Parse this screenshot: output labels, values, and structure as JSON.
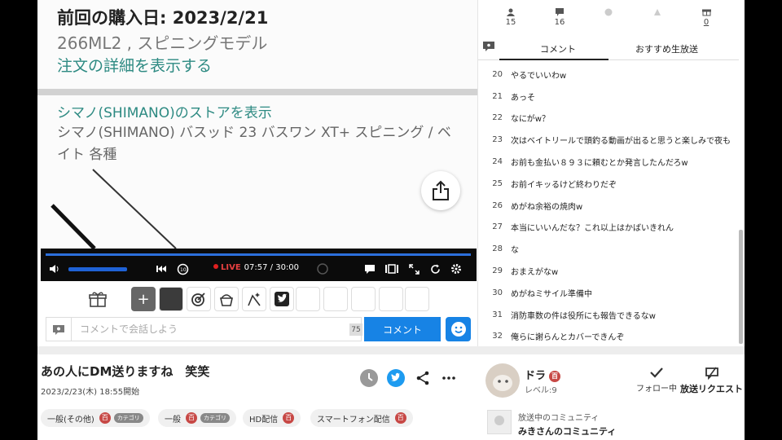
{
  "video": {
    "purchase_date": "前回の購入日: 2023/2/21",
    "purchase_model": "266ML2 , スピニングモデル",
    "order_link": "注文の詳細を表示する",
    "store_link": "シマノ(SHIMANO)のストアを表示",
    "product_name": "シマノ(SHIMANO) バスッド 23 バスワン XT+ スピニング / ベイト 各種"
  },
  "player": {
    "live_label": "LIVE",
    "time": "07:57 / 30:00",
    "progress": 1.0,
    "volume": 0.5
  },
  "comment_form": {
    "placeholder": "コメントで会話しよう",
    "char_count": "75",
    "submit_label": "コメント"
  },
  "program": {
    "title": "あの人にDM送りますね　笑笑",
    "start": "2023/2/23(木) 18:55開始",
    "tags": [
      {
        "label": "一般(その他)",
        "badge": "百",
        "category": "カテゴリ"
      },
      {
        "label": "一般",
        "badge": "百",
        "category": "カテゴリ"
      },
      {
        "label": "HD配信",
        "badge": "百",
        "category": ""
      },
      {
        "label": "スマートフォン配信",
        "badge": "百",
        "category": ""
      }
    ]
  },
  "panel": {
    "stats": [
      {
        "icon": "viewer-icon",
        "value": "15"
      },
      {
        "icon": "comment-count-icon",
        "value": "16"
      },
      {
        "icon": "ad-point-icon",
        "value": ""
      },
      {
        "icon": "gift-point-icon",
        "value": ""
      },
      {
        "icon": "gift-icon",
        "value": "0"
      }
    ],
    "tabs": [
      "コメント",
      "おすすめ生放送"
    ],
    "comments": [
      {
        "no": "20",
        "text": "やるでいいわw"
      },
      {
        "no": "21",
        "text": "あっそ"
      },
      {
        "no": "22",
        "text": "なにがw？"
      },
      {
        "no": "23",
        "text": "次はベイトリールで頭釣る動画が出ると思うと楽しみで夜も"
      },
      {
        "no": "24",
        "text": "お前も金払い８９３に頼むとか発言したんだろw"
      },
      {
        "no": "25",
        "text": "お前イキッるけど終わりだぞ"
      },
      {
        "no": "26",
        "text": "めがね余裕の焼肉w"
      },
      {
        "no": "27",
        "text": "本当にいいんだな？これ以上はかばいきれん"
      },
      {
        "no": "28",
        "text": "な"
      },
      {
        "no": "29",
        "text": "おまえがなw"
      },
      {
        "no": "30",
        "text": "めがねミサイル準備中"
      },
      {
        "no": "31",
        "text": "消防車数の件は役所にも報告できるなw"
      },
      {
        "no": "32",
        "text": "俺らに謝らんとカバーできんぞ"
      }
    ]
  },
  "broadcaster": {
    "name": "ドラ",
    "badge": "百",
    "level": "レベル:9",
    "follow_label": "フォロー中",
    "request_label": "放送リクエスト",
    "community_label": "放送中のコミュニティ",
    "community_name": "みきさんのコミュニティ"
  },
  "colors": {
    "accent_blue": "#1783e5",
    "link_teal": "#2d8a82",
    "live_red": "#e02020",
    "twitter_blue": "#1d9bf0",
    "badge_red": "#c74845"
  }
}
